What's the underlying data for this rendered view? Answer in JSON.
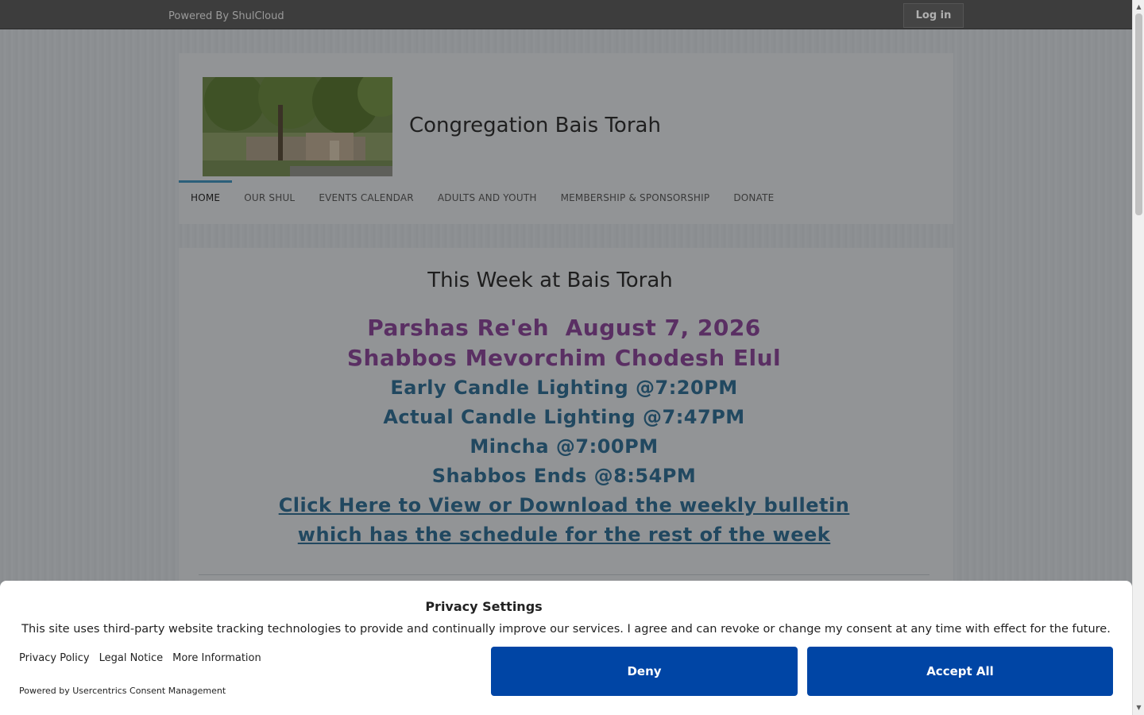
{
  "topbar": {
    "powered_by": "Powered By ShulCloud",
    "login_label": "Log in"
  },
  "header": {
    "site_title": "Congregation Bais Torah",
    "nav": [
      {
        "label": "HOME",
        "active": true
      },
      {
        "label": "OUR SHUL",
        "active": false
      },
      {
        "label": "EVENTS CALENDAR",
        "active": false
      },
      {
        "label": "ADULTS AND YOUTH",
        "active": false
      },
      {
        "label": "MEMBERSHIP & SPONSORSHIP",
        "active": false
      },
      {
        "label": "DONATE",
        "active": false
      }
    ]
  },
  "main": {
    "section_title": "This Week at Bais Torah",
    "parsha_line": "Parshas Re'eh  August 7, 2026",
    "shabbos_line": "Shabbos Mevorchim Chodesh Elul",
    "early_candle": "Early Candle Lighting @7:20PM",
    "actual_candle": "Actual Candle Lighting @7:47PM",
    "mincha": "Mincha @7:00PM",
    "shabbos_ends": "Shabbos Ends @8:54PM",
    "bulletin_link_1": "Click Here to View or Download the weekly bulletin",
    "bulletin_link_2": "which has the schedule for the rest of the week"
  },
  "consent": {
    "title": "Privacy Settings",
    "text": "This site uses third-party website tracking technologies to provide and continually improve our services. I agree and can revoke or change my consent at any time with effect for the future.",
    "links": [
      "Privacy Policy",
      "Legal Notice",
      "More Information"
    ],
    "powered": "Powered by Usercentrics Consent Management",
    "deny_label": "Deny",
    "accept_label": "Accept All"
  },
  "colors": {
    "accent_button": "#0045a5",
    "topbar": "#3d3d3d",
    "purple_text": "#5a2f63",
    "blue_text": "#214860"
  },
  "icons": {
    "logo_image": "building-photo"
  }
}
